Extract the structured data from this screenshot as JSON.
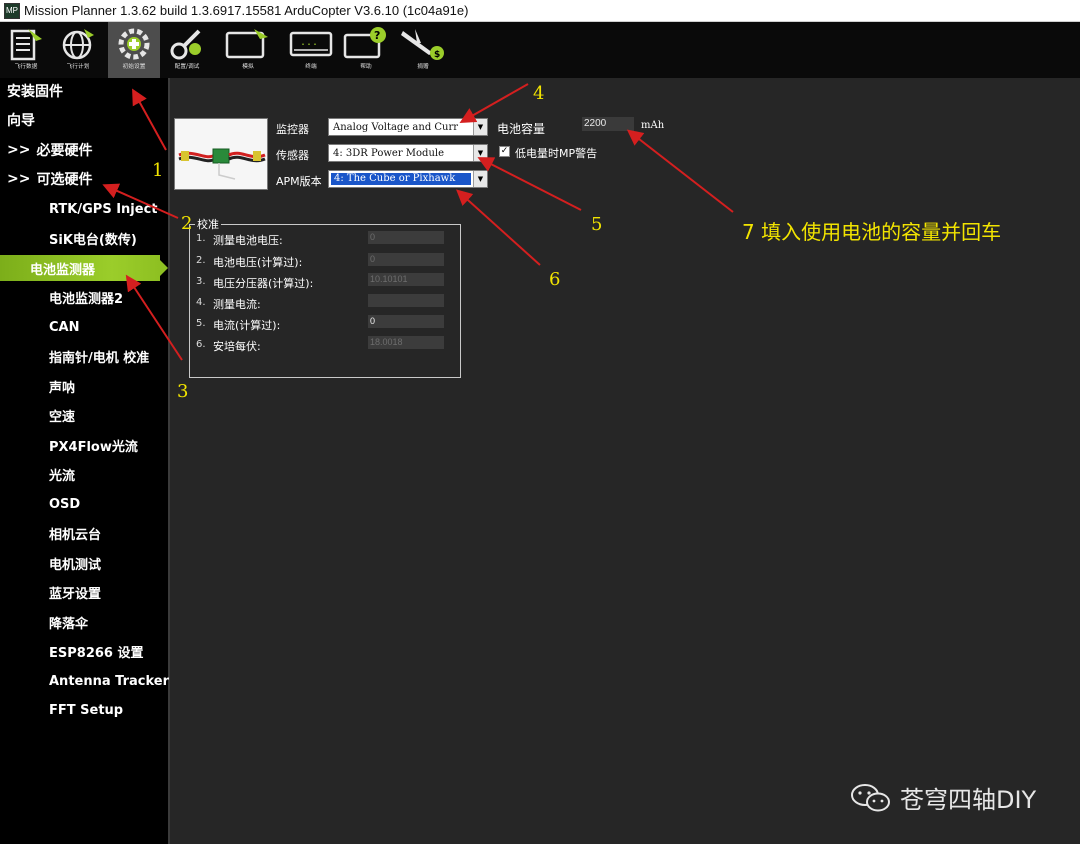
{
  "window": {
    "title": "Mission Planner 1.3.62 build 1.3.6917.15581 ArduCopter V3.6.10 (1c04a91e)",
    "app_icon_text": "MP"
  },
  "toolbar": {
    "items": [
      {
        "label": "飞行数据",
        "icon": "flight-data-icon"
      },
      {
        "label": "飞行计划",
        "icon": "flight-plan-icon"
      },
      {
        "label": "初始设置",
        "icon": "initial-setup-icon",
        "active": true
      },
      {
        "label": "配置/调试",
        "icon": "config-tuning-icon"
      },
      {
        "label": "模拟",
        "icon": "simulation-icon"
      },
      {
        "label": "终端",
        "icon": "terminal-icon"
      },
      {
        "label": "帮助",
        "icon": "help-icon"
      },
      {
        "label": "捐赠",
        "icon": "donate-icon"
      }
    ]
  },
  "sidebar": {
    "items": [
      {
        "label": "安装固件",
        "level": 0
      },
      {
        "label": "向导",
        "level": 0
      },
      {
        "label": "必要硬件",
        "level": 0,
        "prefix": ">>"
      },
      {
        "label": "可选硬件",
        "level": 0,
        "prefix": ">>"
      },
      {
        "label": "RTK/GPS Inject",
        "level": 1
      },
      {
        "label": "SiK电台(数传)",
        "level": 1
      },
      {
        "label": "电池监测器",
        "level": 1,
        "selected": true
      },
      {
        "label": "电池监测器2",
        "level": 1
      },
      {
        "label": "CAN",
        "level": 1
      },
      {
        "label": "指南针/电机 校准",
        "level": 1
      },
      {
        "label": "声呐",
        "level": 1
      },
      {
        "label": "空速",
        "level": 1
      },
      {
        "label": "PX4Flow光流",
        "level": 1
      },
      {
        "label": "光流",
        "level": 1
      },
      {
        "label": "OSD",
        "level": 1
      },
      {
        "label": "相机云台",
        "level": 1
      },
      {
        "label": "电机测试",
        "level": 1
      },
      {
        "label": "蓝牙设置",
        "level": 1
      },
      {
        "label": "降落伞",
        "level": 1
      },
      {
        "label": "ESP8266 设置",
        "level": 1
      },
      {
        "label": "Antenna Tracker",
        "level": 1
      },
      {
        "label": "FFT Setup",
        "level": 1
      }
    ],
    "selected_color": "#8ec022"
  },
  "battery": {
    "monitor_label": "监控器",
    "monitor_value": "Analog Voltage and Curr",
    "sensor_label": "传感器",
    "sensor_value": "4: 3DR Power Module",
    "apm_label": "APM版本",
    "apm_value": "4: The Cube or Pixhawk",
    "capacity_label": "电池容量",
    "capacity_value": "2200",
    "capacity_unit": "mAh",
    "mp_alert_label": "低电量时MP警告",
    "mp_alert_checked": true
  },
  "calibration": {
    "title": "校准",
    "rows": [
      {
        "num": "1.",
        "label": "测量电池电压:",
        "value": "0"
      },
      {
        "num": "2.",
        "label": "电池电压(计算过):",
        "value": "0"
      },
      {
        "num": "3.",
        "label": "电压分压器(计算过):",
        "value": "10.10101"
      },
      {
        "num": "4.",
        "label": "测量电流:",
        "value": ""
      },
      {
        "num": "5.",
        "label": "电流(计算过):",
        "value": "0"
      },
      {
        "num": "6.",
        "label": "安培每伏:",
        "value": "18.0018"
      }
    ]
  },
  "annotations": {
    "n1": "1",
    "n2": "2",
    "n3": "3",
    "n4": "4",
    "n5": "5",
    "n6": "6",
    "n7": "7  填入使用电池的容量并回车",
    "color": "#f2e400",
    "arrow_color": "#d41f1f"
  },
  "watermark": {
    "text": "苍穹四轴DIY",
    "icon": "wechat-icon"
  }
}
